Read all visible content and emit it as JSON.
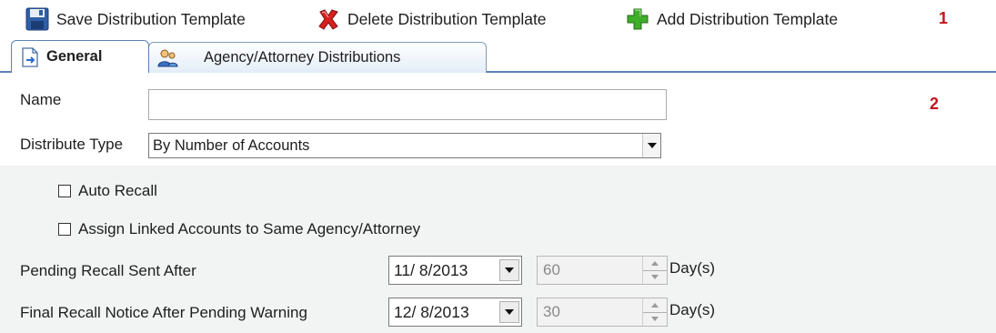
{
  "toolbar": {
    "save_label": "Save Distribution Template",
    "save_icon": "floppy-disk-icon",
    "delete_label": "Delete Distribution Template",
    "delete_icon": "red-x-icon",
    "add_label": "Add Distribution Template",
    "add_icon": "green-plus-icon",
    "callout": "1"
  },
  "tabs": [
    {
      "label": "General",
      "icon": "document-arrow-icon",
      "active": true
    },
    {
      "label": "Agency/Attorney Distributions",
      "icon": "users-icon",
      "active": false
    }
  ],
  "form": {
    "callout": "2",
    "name": {
      "label": "Name",
      "value": ""
    },
    "distribute_type": {
      "label": "Distribute Type",
      "value": "By Number of Accounts"
    },
    "auto_recall": {
      "label": "Auto Recall",
      "checked": false
    },
    "assign_linked": {
      "label": "Assign Linked Accounts to Same Agency/Attorney",
      "checked": false
    },
    "pending_recall": {
      "label": "Pending Recall Sent After",
      "date": "11/ 8/2013",
      "days": "60",
      "unit": "Day(s)"
    },
    "final_recall": {
      "label": "Final Recall Notice After Pending Warning",
      "date": "12/ 8/2013",
      "days": "30",
      "unit": "Day(s)"
    }
  },
  "colors": {
    "callout_red": "#c0171d",
    "tab_border": "#5a82b5",
    "panel_bg": "#f2f4f3"
  }
}
